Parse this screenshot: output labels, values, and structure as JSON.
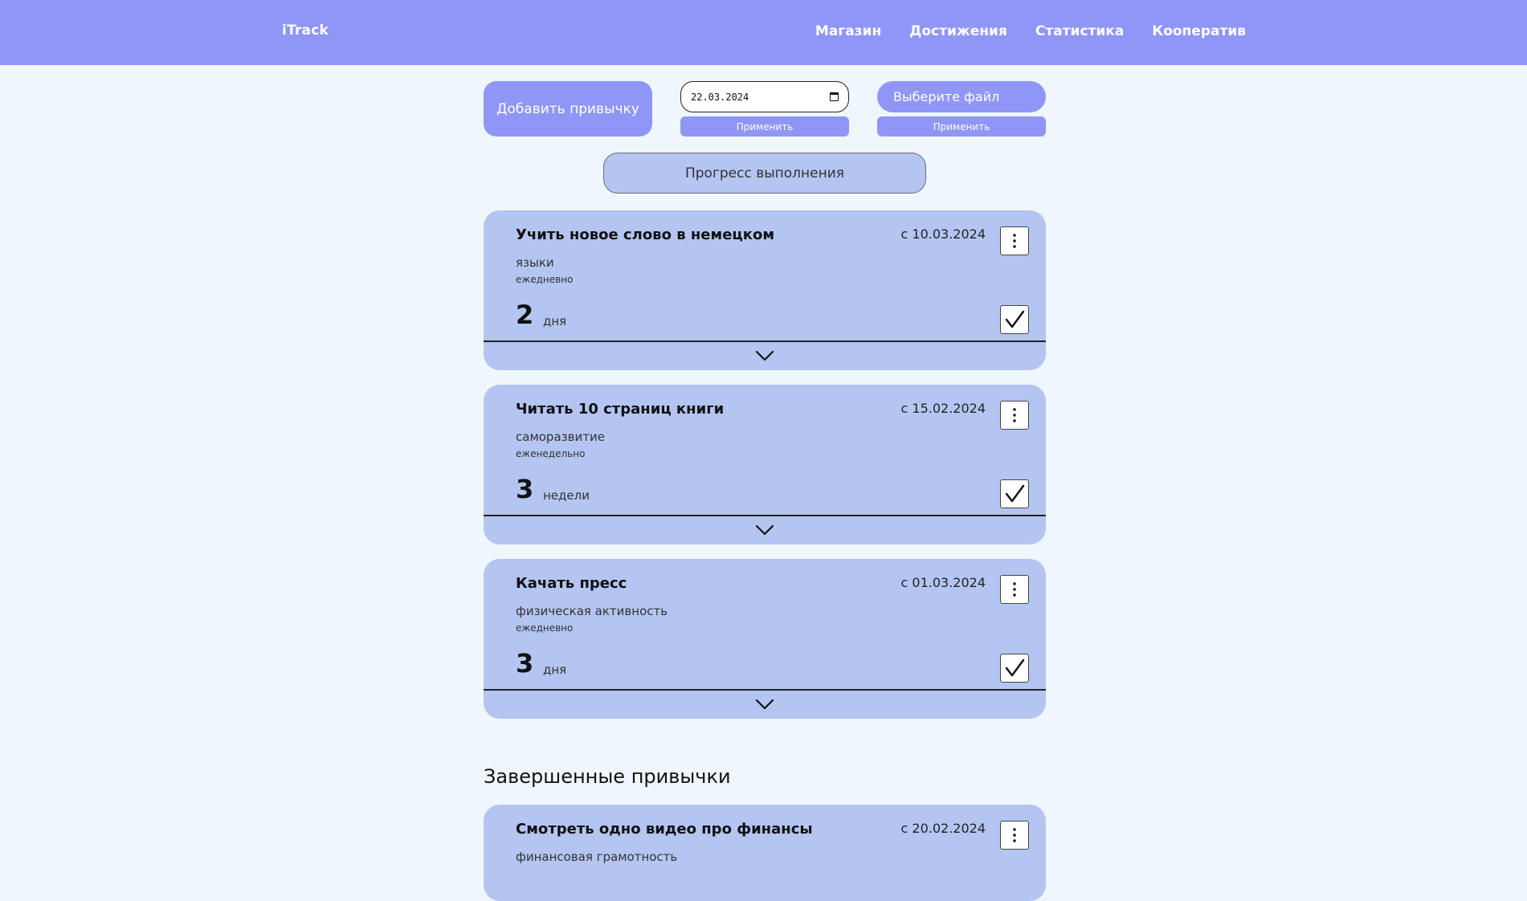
{
  "header": {
    "logo": "iTrack",
    "nav": [
      "Магазин",
      "Достижения",
      "Статистика",
      "Кооператив"
    ]
  },
  "controls": {
    "add_habit": "Добавить привычку",
    "date_value": "22.03.2024",
    "apply": "Применить",
    "choose_file": "Выберите файл",
    "progress": "Прогресс выполнения"
  },
  "habits": [
    {
      "title": "Учить новое слово в немецком",
      "since": "с 10.03.2024",
      "category": "языки",
      "frequency": "ежедневно",
      "count": "2",
      "unit": "дня",
      "checked": true
    },
    {
      "title": "Читать 10 страниц книги",
      "since": "с 15.02.2024",
      "category": "саморазвитие",
      "frequency": "еженедельно",
      "count": "3",
      "unit": "недели",
      "checked": true
    },
    {
      "title": "Качать пресс",
      "since": "с 01.03.2024",
      "category": "физическая активность",
      "frequency": "ежедневно",
      "count": "3",
      "unit": "дня",
      "checked": true
    }
  ],
  "completed": {
    "title": "Завершенные привычки",
    "items": [
      {
        "title": "Смотреть одно видео про финансы",
        "since": "с 20.02.2024",
        "category": "финансовая грамотность"
      }
    ]
  },
  "icons": {
    "menu": "more-vertical-icon",
    "check": "checkmark-icon",
    "expand": "chevron-down-icon",
    "calendar": "calendar-icon"
  },
  "colors": {
    "header_bg": "#8f96f6",
    "page_bg": "#eff7fd",
    "card_bg": "#b4c5f2",
    "button_bg": "#8f96f6"
  }
}
